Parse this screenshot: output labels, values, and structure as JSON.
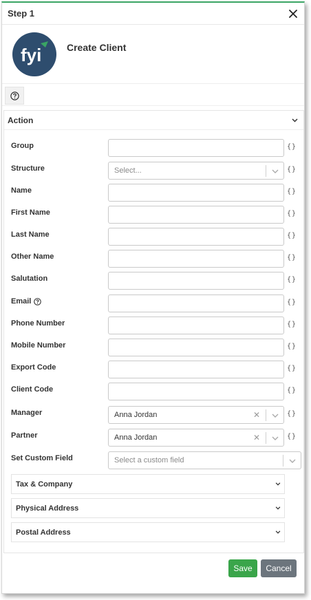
{
  "dialog": {
    "title": "Step 1",
    "header_title": "Create Client",
    "logo_text": "fyi"
  },
  "panel": {
    "title": "Action"
  },
  "fields": [
    {
      "label": "Group",
      "type": "text",
      "value": ""
    },
    {
      "label": "Structure",
      "type": "select",
      "placeholder": "Select..."
    },
    {
      "label": "Name",
      "type": "text",
      "value": ""
    },
    {
      "label": "First Name",
      "type": "text",
      "value": ""
    },
    {
      "label": "Last Name",
      "type": "text",
      "value": ""
    },
    {
      "label": "Other Name",
      "type": "text",
      "value": ""
    },
    {
      "label": "Salutation",
      "type": "text",
      "value": ""
    },
    {
      "label": "Email",
      "type": "text",
      "value": "",
      "help_icon": "question-circle-icon"
    },
    {
      "label": "Phone Number",
      "type": "text",
      "value": ""
    },
    {
      "label": "Mobile Number",
      "type": "text",
      "value": ""
    },
    {
      "label": "Export Code",
      "type": "text",
      "value": ""
    },
    {
      "label": "Client Code",
      "type": "text",
      "value": ""
    },
    {
      "label": "Manager",
      "type": "select",
      "value": "Anna Jordan"
    },
    {
      "label": "Partner",
      "type": "select",
      "value": "Anna Jordan"
    },
    {
      "label": "Set Custom Field",
      "type": "select",
      "placeholder": "Select a custom field"
    }
  ],
  "braces_label": "{}",
  "sections": [
    {
      "label": "Tax & Company"
    },
    {
      "label": "Physical Address"
    },
    {
      "label": "Postal Address"
    }
  ],
  "buttons": {
    "save": "Save",
    "cancel": "Cancel"
  },
  "colors": {
    "accent": "#3aa564",
    "logo_bg": "#2e4d6e",
    "save_bg": "#3aa54a",
    "cancel_bg": "#6c757d"
  }
}
